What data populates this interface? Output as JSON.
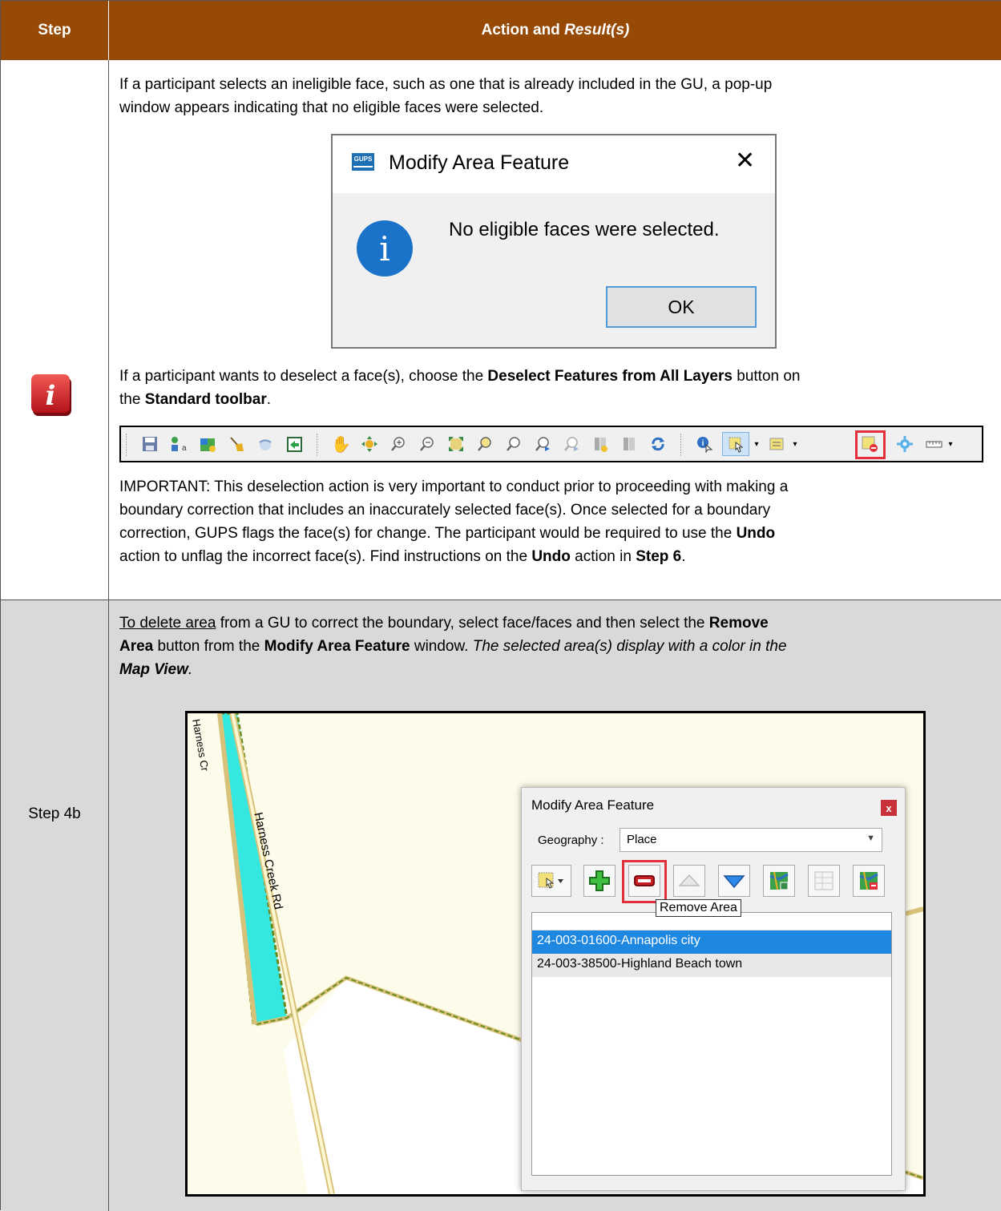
{
  "header": {
    "step_col": "Step",
    "action_col_a": "Action and ",
    "action_col_b": "Result(s)"
  },
  "row1": {
    "para1_l1": "If a participant selects an ineligible face, such as one that is already included in the GU, a pop-up",
    "para1_l2": "window appears indicating that no eligible faces were selected.",
    "dialog": {
      "logo": "GUPS",
      "title": "Modify Area Feature",
      "close": "✕",
      "message": "No eligible faces were selected.",
      "ok": "OK"
    },
    "para2_l1_a": "If a participant wants to deselect a face(s), choose the ",
    "para2_l1_b": "Deselect Features from All Layers",
    "para2_l1_c": " button on",
    "para2_l2_a": "the ",
    "para2_l2_b": "Standard toolbar",
    "para2_l2_c": ".",
    "para3_l1": "IMPORTANT: This deselection action is very important to conduct prior to proceeding with making a",
    "para3_l2": "boundary correction that includes an inaccurately selected face(s). Once selected for a boundary",
    "para3_l3_a": "correction, GUPS flags the face(s) for change. The participant would be required to use the ",
    "para3_l3_b": "Undo",
    "para3_l4_a": "action to unflag the incorrect face(s). Find instructions on the ",
    "para3_l4_b": "Undo",
    "para3_l4_c": " action in ",
    "para3_l4_d": "Step 6",
    "para3_l4_e": "."
  },
  "row2": {
    "step": "Step 4b",
    "l1_a": "To delete area",
    "l1_b": " from a GU to correct the boundary, select face/faces and then select the ",
    "l1_c": "Remove",
    "l2_a": "Area",
    "l2_b": " button from the ",
    "l2_c": "Modify Area Feature",
    "l2_d": " window. ",
    "l2_e": "The selected area(s) display with a color in the",
    "l3_a": "Map View",
    "l3_b": ".",
    "map": {
      "road1": "Harness Cr",
      "road2": "Harness Creek Rd",
      "dialog_title": "Modify Area Feature",
      "close": "x",
      "geo_label": "Geography :",
      "geo_value": "Place",
      "tooltip": "Remove Area",
      "items": [
        "24-003-01600-Annapolis city",
        "24-003-38500-Highland Beach town"
      ]
    }
  }
}
